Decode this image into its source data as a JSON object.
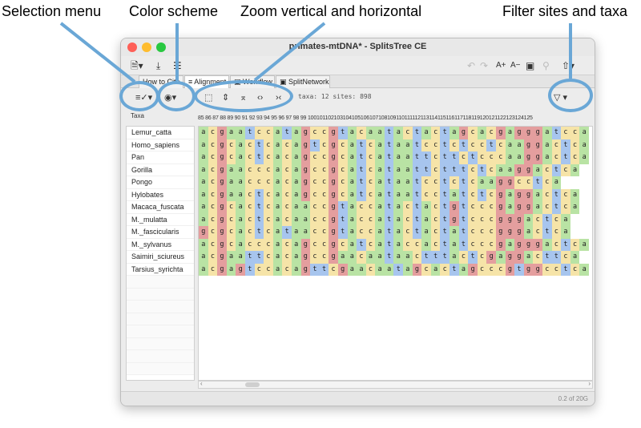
{
  "annotations": {
    "selection_menu": "Selection menu",
    "color_scheme": "Color scheme",
    "zoom": "Zoom vertical and horizontal",
    "filter": "Filter sites and taxa"
  },
  "window": {
    "title": "primates-mtDNA* - SplitsTree CE"
  },
  "toolbar": {
    "new_icon": "new-document-icon",
    "save_icon": "save-icon",
    "print_icon": "print-icon",
    "undo_icon": "undo-icon",
    "redo_icon": "redo-icon",
    "font_increase": "A+",
    "font_decrease": "A−",
    "fit_icon": "fit-window-icon",
    "find_icon": "find-icon",
    "share_icon": "export-icon"
  },
  "tabs": [
    {
      "label": "How to Cite"
    },
    {
      "label": "Alignment"
    },
    {
      "label": "Workflow"
    },
    {
      "label": "SplitNetwork"
    }
  ],
  "alignment_toolbar": {
    "info": "taxa: 12 sites: 898"
  },
  "taxa_header": "Taxa",
  "ruler": "85 86 87 88 89 90 91 92 93 94 95 96 97 98 99 100101102103104105106107108109110111112113114115116117118119120121122123124125",
  "taxa": [
    "Lemur_catta",
    "Homo_sapiens",
    "Pan",
    "Gorilla",
    "Pongo",
    "Hylobates",
    "Macaca_fuscata",
    "M._mulatta",
    "M._fascicularis",
    "M._sylvanus",
    "Saimiri_sciureus",
    "Tarsius_syrichta"
  ],
  "sequences": [
    "acgaatccatagccgtacaatactactagcacgagggatcca",
    "acgcactcacagtcgcatcataatcctctcctcaaggactca",
    "acgcactcacagccgcatcataattcttctcccaaggactca",
    "acgaacccacagccgcatcataattctttctcaaggactca",
    "acgaacccacagccgcatcataatcctctcaaggcctca",
    "acgaactcacagccgcatcataatcctatctcgaggactca",
    "acgcactcacaaccgtaccatactactgtcccgaggactca",
    "acgcactcacaaccgtaccatactactgtcccgggactca",
    "gcgcactcataaccgtaccatactactatcccgggactca",
    "acgcacccacagccgcatcataccactatcccgagggactca",
    "acgaattcacagccgaacaataactttactcgaggacttca",
    "acgagtccacagttcgaacaatagcactagcccgtggcctca"
  ],
  "status": "0.2 of 20G"
}
